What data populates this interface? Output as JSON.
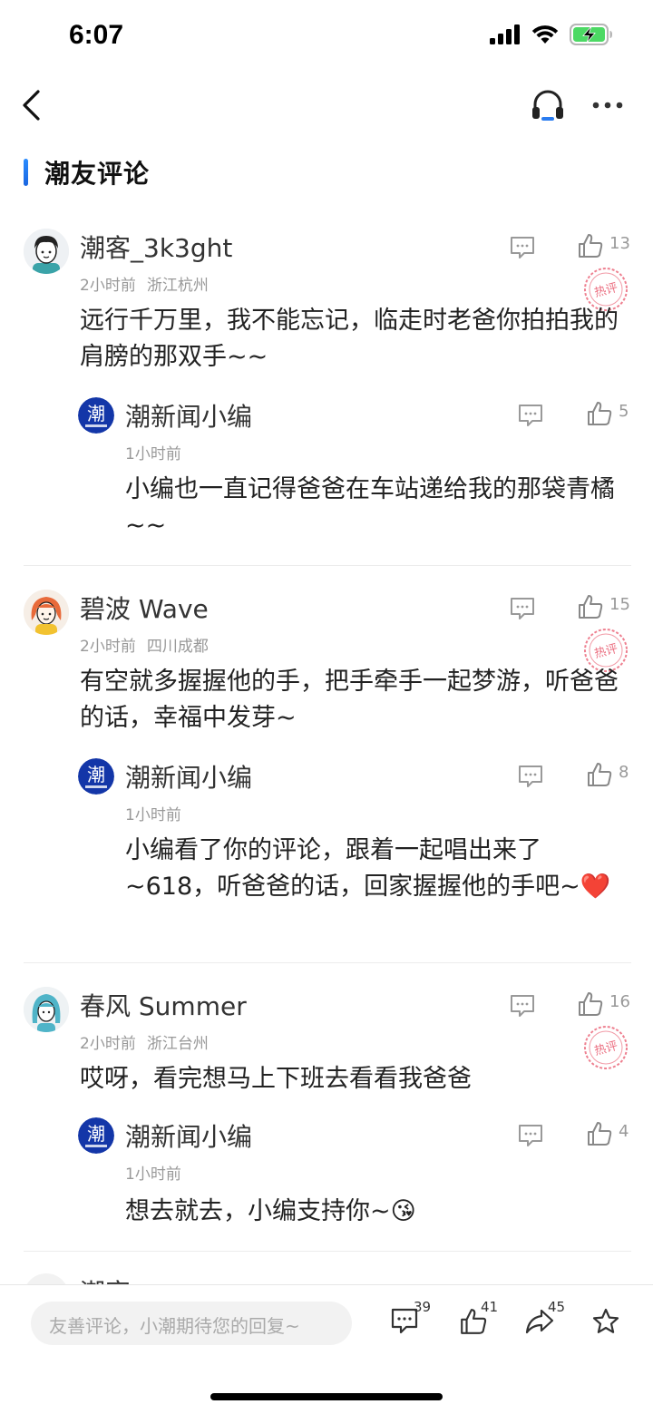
{
  "status_bar": {
    "time": "6:07",
    "battery_state": "charging"
  },
  "nav": {
    "back_icon": "chevron-left-icon",
    "listen_icon": "headset-icon",
    "more_icon": "more-dots-icon"
  },
  "section": {
    "title": "潮友评论"
  },
  "comments": [
    {
      "user": "潮客_3k3ght",
      "time": "2小时前",
      "location": "浙江杭州",
      "text": "远行千万里，我不能忘记，临走时老爸你拍拍我的肩膀的那双手~~",
      "likes": "13",
      "stamp": "热评",
      "reply": {
        "user": "潮新闻小编",
        "time": "1小时前",
        "text": "小编也一直记得爸爸在车站递给我的那袋青橘~~",
        "likes": "5"
      }
    },
    {
      "user": "碧波 Wave",
      "time": "2小时前",
      "location": "四川成都",
      "text": "有空就多握握他的手，把手牵手一起梦游，听爸爸的话，幸福中发芽~",
      "likes": "15",
      "stamp": "热评",
      "reply": {
        "user": "潮新闻小编",
        "time": "1小时前",
        "text": "小编看了你的评论，跟着一起唱出来了~618，听爸爸的话，回家握握他的手吧~❤️",
        "likes": "8"
      }
    },
    {
      "user": "春风 Summer",
      "time": "2小时前",
      "location": "浙江台州",
      "text": "哎呀，看完想马上下班去看看我爸爸",
      "likes": "16",
      "stamp": "热评",
      "reply": {
        "user": "潮新闻小编",
        "time": "1小时前",
        "text": "想去就去，小编支持你~😘",
        "likes": "4"
      }
    }
  ],
  "partial_next_user": "潮客_",
  "bottom_bar": {
    "input_placeholder": "友善评论，小潮期待您的回复~",
    "comment_count": "39",
    "like_count": "41",
    "share_count": "45",
    "favorite_icon": "star-icon"
  },
  "colors": {
    "accent": "#1a66e0",
    "brand_navy": "#1336a8",
    "stamp_red": "#e8566b",
    "muted_text": "#999999"
  }
}
